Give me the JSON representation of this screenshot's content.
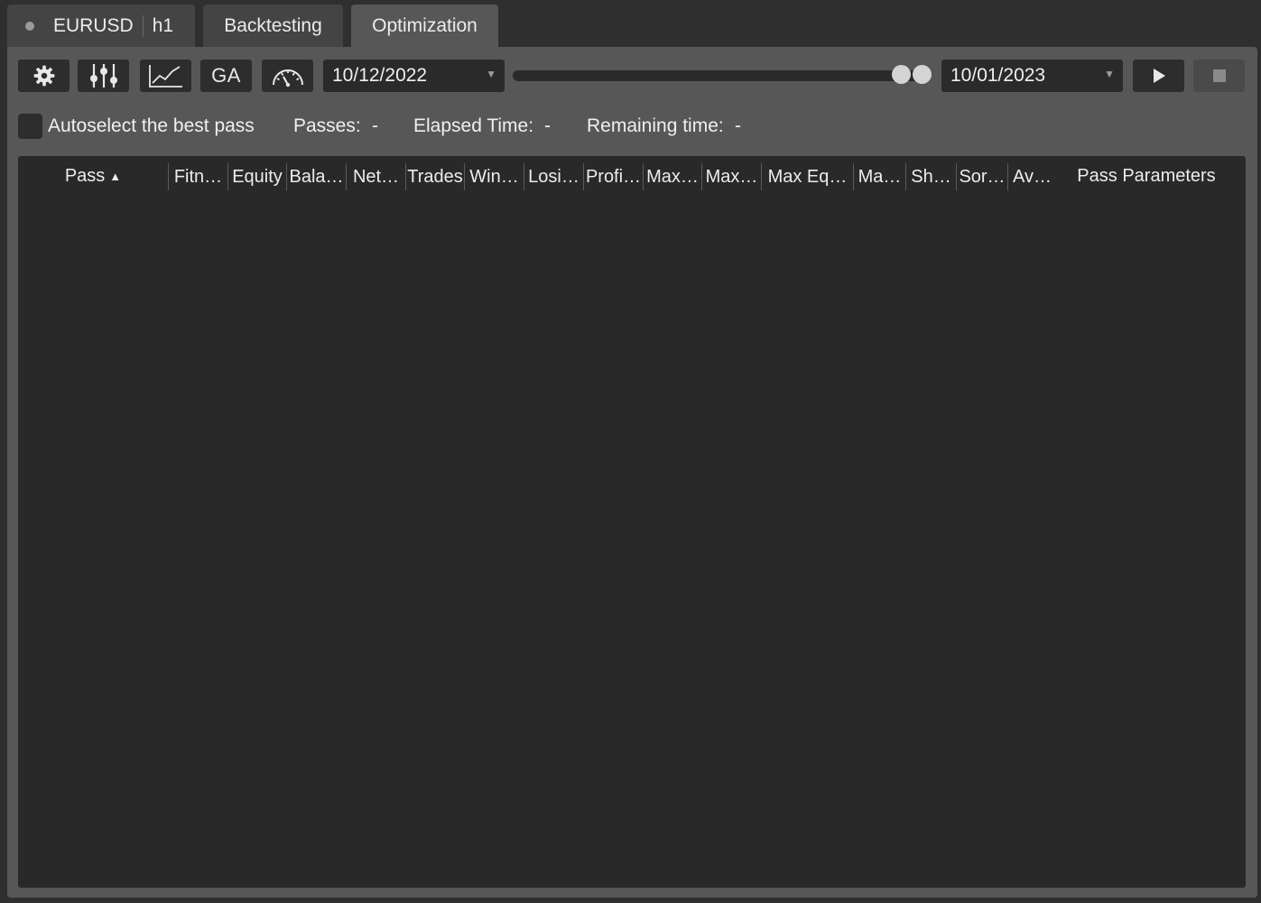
{
  "tabs": {
    "symbol": "EURUSD",
    "timeframe": "h1",
    "backtesting": "Backtesting",
    "optimization": "Optimization",
    "active": "Optimization"
  },
  "toolbar": {
    "settings_icon": "gear-icon",
    "parameters_icon": "sliders-icon",
    "chart_icon": "line-chart-icon",
    "ga_label": "GA",
    "speed_icon": "speedometer-icon",
    "start_date": "10/12/2022",
    "end_date": "10/01/2023",
    "play_icon": "play-icon",
    "stop_icon": "stop-icon"
  },
  "status": {
    "autoselect_label": "Autoselect the best pass",
    "autoselect_checked": false,
    "passes_label": "Passes:",
    "passes_value": "-",
    "elapsed_label": "Elapsed Time:",
    "elapsed_value": "-",
    "remaining_label": "Remaining time:",
    "remaining_value": "-"
  },
  "table": {
    "columns": [
      "Pass",
      "Fitn…",
      "Equity",
      "Bala…",
      "Net…",
      "Trades",
      "Win…",
      "Losi…",
      "Profi…",
      "Max…",
      "Max…",
      "Max Eq…",
      "Ma…",
      "Sh…",
      "Sor…",
      "Av…",
      "Pass Parameters"
    ],
    "sort_column": "Pass",
    "sort_direction": "ascending",
    "rows": []
  },
  "colors": {
    "background": "#2f2f2f",
    "panel": "#575757",
    "table_bg": "#292929",
    "accent": "#1fa86b"
  }
}
